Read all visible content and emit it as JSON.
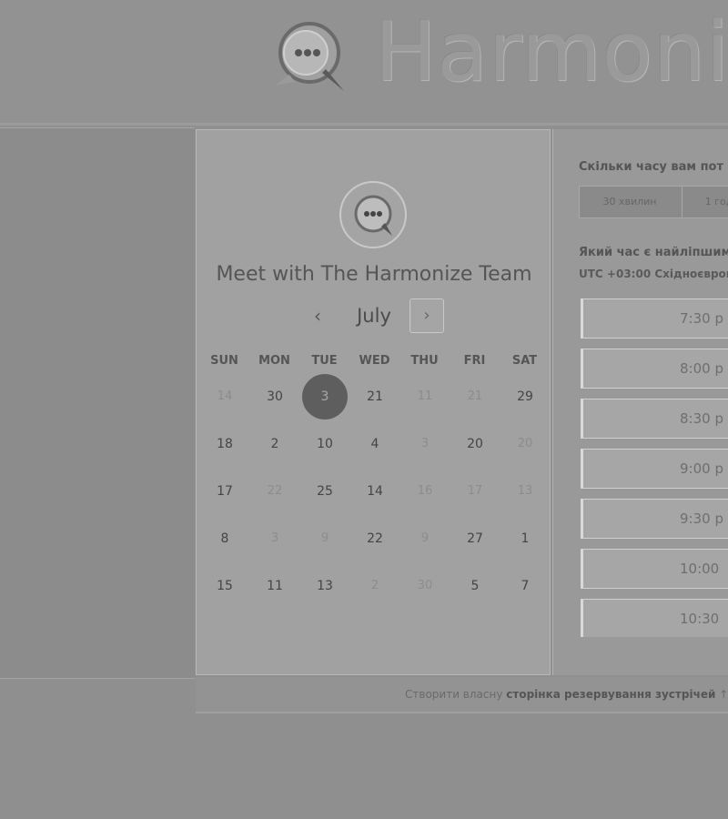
{
  "header": {
    "brand": "Harmoni"
  },
  "calendar": {
    "title": "Meet with The Harmonize Team",
    "month": "July",
    "prev_icon": "‹",
    "next_icon": "›",
    "weekdays": [
      "SUN",
      "MON",
      "TUE",
      "WED",
      "THU",
      "FRI",
      "SAT"
    ],
    "weeks": [
      [
        {
          "d": "14",
          "m": true
        },
        {
          "d": "30",
          "m": false
        },
        {
          "d": "3",
          "m": false,
          "sel": true
        },
        {
          "d": "21",
          "m": false
        },
        {
          "d": "11",
          "m": true
        },
        {
          "d": "21",
          "m": true
        },
        {
          "d": "29",
          "m": false
        }
      ],
      [
        {
          "d": "18",
          "m": false
        },
        {
          "d": "2",
          "m": false
        },
        {
          "d": "10",
          "m": false
        },
        {
          "d": "4",
          "m": false
        },
        {
          "d": "3",
          "m": true
        },
        {
          "d": "20",
          "m": false
        },
        {
          "d": "20",
          "m": true
        }
      ],
      [
        {
          "d": "17",
          "m": false
        },
        {
          "d": "22",
          "m": true
        },
        {
          "d": "25",
          "m": false
        },
        {
          "d": "14",
          "m": false
        },
        {
          "d": "16",
          "m": true
        },
        {
          "d": "17",
          "m": true
        },
        {
          "d": "13",
          "m": true
        }
      ],
      [
        {
          "d": "8",
          "m": false
        },
        {
          "d": "3",
          "m": true
        },
        {
          "d": "9",
          "m": true
        },
        {
          "d": "22",
          "m": false
        },
        {
          "d": "9",
          "m": true
        },
        {
          "d": "27",
          "m": false
        },
        {
          "d": "1",
          "m": false
        }
      ],
      [
        {
          "d": "15",
          "m": false
        },
        {
          "d": "11",
          "m": false
        },
        {
          "d": "13",
          "m": false
        },
        {
          "d": "2",
          "m": true
        },
        {
          "d": "30",
          "m": true
        },
        {
          "d": "5",
          "m": false
        },
        {
          "d": "7",
          "m": false
        }
      ]
    ]
  },
  "booking": {
    "duration_question": "Скільки часу вам пот",
    "durations": [
      "30 хвилин",
      "1 год"
    ],
    "time_question": "Який час є найліпшим",
    "timezone": "UTC +03:00 Східноєвроп",
    "slots": [
      "7:30 p",
      "8:00 p",
      "8:30 p",
      "9:00 p",
      "9:30 p",
      "10:00",
      "10:30"
    ]
  },
  "footer": {
    "prefix": "Створити власну",
    "link": "сторінка резервування зустрічей",
    "suffix": "↑"
  },
  "colors": {
    "selected_day": "#5e5e5e",
    "page_bg": "#8f8f8f"
  }
}
